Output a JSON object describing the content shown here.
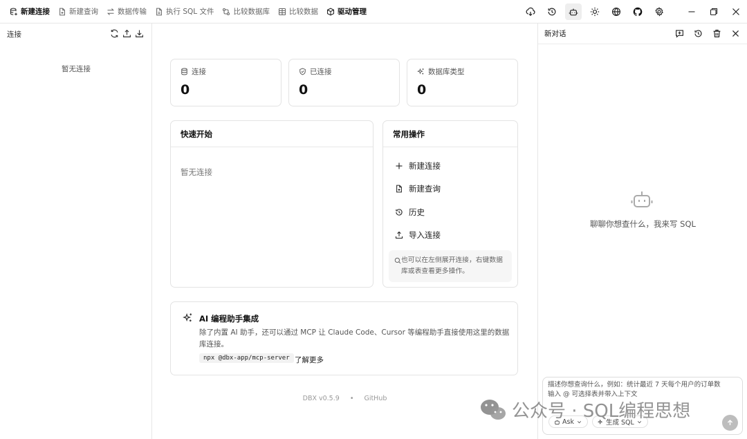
{
  "toolbar": {
    "items": [
      {
        "label": "新建连接",
        "icon": "new-connection-icon",
        "active": true
      },
      {
        "label": "新建查询",
        "icon": "new-query-icon"
      },
      {
        "label": "数据传输",
        "icon": "transfer-icon"
      },
      {
        "label": "执行 SQL 文件",
        "icon": "sql-file-icon"
      },
      {
        "label": "比较数据库",
        "icon": "compare-db-icon"
      },
      {
        "label": "比较数据",
        "icon": "compare-data-icon"
      },
      {
        "label": "驱动管理",
        "icon": "driver-icon",
        "active": true
      }
    ],
    "right_icons": [
      "cloud-download-icon",
      "history-icon",
      "robot-icon",
      "sun-icon",
      "globe-icon",
      "github-icon",
      "gear-icon"
    ],
    "window_controls": [
      "minimize-icon",
      "restore-icon",
      "close-icon"
    ]
  },
  "sidebar": {
    "title": "连接",
    "actions": [
      "refresh-icon",
      "upload-icon",
      "download-icon"
    ],
    "empty": "暂无连接"
  },
  "stats": [
    {
      "label": "连接",
      "value": "0",
      "icon": "database-icon"
    },
    {
      "label": "已连接",
      "value": "0",
      "icon": "shield-check-icon"
    },
    {
      "label": "数据库类型",
      "value": "0",
      "icon": "sparkles-icon"
    }
  ],
  "quick_start": {
    "title": "快速开始",
    "empty": "暂无连接"
  },
  "common_ops": {
    "title": "常用操作",
    "items": [
      {
        "label": "新建连接",
        "icon": "plus-icon"
      },
      {
        "label": "新建查询",
        "icon": "new-query-icon"
      },
      {
        "label": "历史",
        "icon": "history-icon"
      },
      {
        "label": "导入连接",
        "icon": "upload-icon"
      }
    ],
    "hint": "也可以在左侧展开连接，右键数据库或表查看更多操作。"
  },
  "ai_card": {
    "title": "AI 编程助手集成",
    "desc": "除了内置 AI 助手，还可以通过 MCP 让 Claude Code、Cursor 等编程助手直接使用这里的数据库连接。",
    "code": "npx @dbx-app/mcp-server",
    "link": "了解更多"
  },
  "footer": {
    "version": "DBX v0.5.9",
    "sep": "•",
    "link": "GitHub"
  },
  "chat": {
    "title": "新对话",
    "actions": [
      "new-chat-icon",
      "history-icon",
      "trash-icon",
      "close-icon"
    ],
    "empty": "聊聊你想查什么，我来写 SQL",
    "placeholder": "描述你想查询什么，例如：统计最近 7 天每个用户的订单数\n输入 @ 可选择表并带入上下文",
    "mode": "Ask",
    "action": "生成 SQL"
  },
  "watermark": "公众号 · SQL编程思想"
}
